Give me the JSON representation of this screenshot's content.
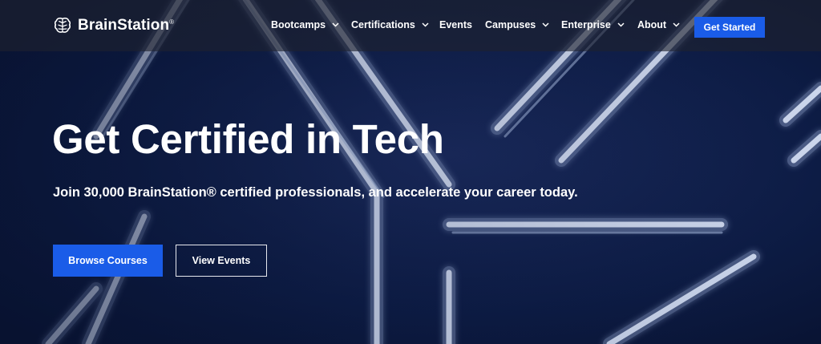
{
  "brand": {
    "name": "BrainStation",
    "trademark": "®",
    "logo_icon": "brain-icon"
  },
  "nav": {
    "items": [
      {
        "label": "Bootcamps",
        "has_dropdown": true
      },
      {
        "label": "Certifications",
        "has_dropdown": true
      },
      {
        "label": "Events",
        "has_dropdown": false
      },
      {
        "label": "Campuses",
        "has_dropdown": true
      },
      {
        "label": "Enterprise",
        "has_dropdown": true
      },
      {
        "label": "About",
        "has_dropdown": true
      }
    ],
    "cta_label": "Get Started"
  },
  "hero": {
    "title": "Get Certified in Tech",
    "subtitle": "Join 30,000 BrainStation® certified professionals, and accelerate your career today.",
    "primary_button": "Browse Courses",
    "secondary_button": "View Events",
    "background": "neon-tubes-image"
  },
  "colors": {
    "accent": "#1a5ce8",
    "header_bg": "#1e222e",
    "hero_bg": "#0c1a3e",
    "neon": "#c9d5ec"
  }
}
